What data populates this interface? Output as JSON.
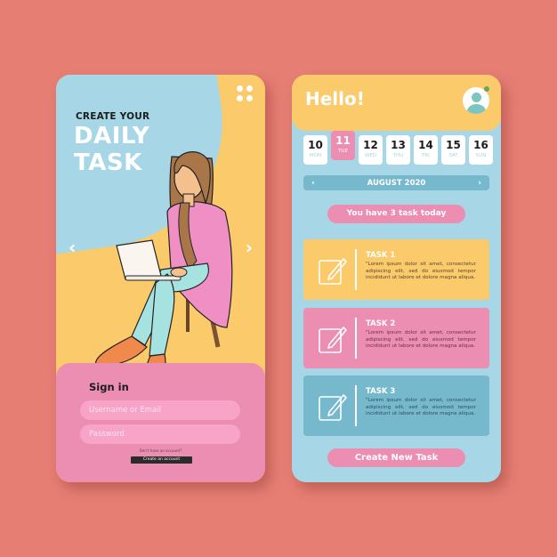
{
  "colors": {
    "background": "#e67e74",
    "yellow": "#fbca6a",
    "blue": "#a7d7e7",
    "pink": "#ec8db2",
    "dark_blue": "#76b9cd"
  },
  "login_screen": {
    "menu_icon": "grid-dots-icon",
    "subtitle": "CREATE YOUR",
    "title_line1": "DAILY",
    "title_line2": "TASK",
    "prev_arrow": "‹",
    "next_arrow": "›",
    "illustration": "woman-with-laptop-on-chair",
    "signin": {
      "title": "Sign in",
      "username_placeholder": "Username or Email",
      "password_placeholder": "Password",
      "no_account_text": "Don't have an account?",
      "create_account_label": "Create an account"
    }
  },
  "tasks_screen": {
    "greeting": "Hello!",
    "avatar_icon": "user-avatar-icon",
    "calendar": {
      "days": [
        {
          "num": "10",
          "dow": "MON",
          "active": false
        },
        {
          "num": "11",
          "dow": "TUE",
          "active": true
        },
        {
          "num": "12",
          "dow": "WED",
          "active": false
        },
        {
          "num": "13",
          "dow": "THU",
          "active": false
        },
        {
          "num": "14",
          "dow": "FRI",
          "active": false
        },
        {
          "num": "15",
          "dow": "SAT",
          "active": false
        },
        {
          "num": "16",
          "dow": "SUN",
          "active": false
        }
      ],
      "month_label": "AUGUST 2020",
      "prev": "‹",
      "next": "›"
    },
    "summary": "You have 3 task today",
    "tasks": [
      {
        "name": "TASK 1",
        "description": "\"Lorem ipsum dolor sit amet, consectetur adipiscing elit, sed do eiusmod tempor incididunt ut labore et dolore magna aliqua."
      },
      {
        "name": "TASK 2",
        "description": "\"Lorem ipsum dolor sit amet, consectetur adipiscing elit, sed do eiusmod tempor incididunt ut labore et dolore magna aliqua."
      },
      {
        "name": "TASK 3",
        "description": "\"Lorem ipsum dolor sit amet, consectetur adipiscing elit, sed do eiusmod tempor incididunt ut labore et dolore magna aliqua."
      }
    ],
    "create_button_label": "Create New Task"
  }
}
